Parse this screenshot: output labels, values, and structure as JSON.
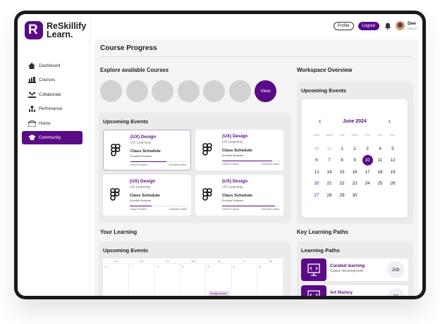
{
  "brand": {
    "line1": "ReSkillify",
    "line2": "Learn.",
    "mark": "R"
  },
  "nav": [
    {
      "label": "Dashboard",
      "icon": "home-icon",
      "active": false
    },
    {
      "label": "Courses",
      "icon": "courses-icon",
      "active": false
    },
    {
      "label": "Collaborate",
      "icon": "collaborate-icon",
      "active": false
    },
    {
      "label": "Perfomance",
      "icon": "performance-icon",
      "active": false
    },
    {
      "label": "Home",
      "icon": "home-alt-icon",
      "active": false
    },
    {
      "label": "Community",
      "icon": "community-icon",
      "active": true
    }
  ],
  "topbar": {
    "profile": "Profile",
    "logout": "Logout",
    "user_name": "Dee",
    "user_role": "User"
  },
  "main": {
    "title": "Course Progress",
    "explore_title": "Explore available Courses",
    "view_label": "View",
    "upcoming_title": "Upcoming Events",
    "cards": [
      {
        "title": "(UX) Design",
        "sub": "UX Learning",
        "schedule": "Class Schedule",
        "enrolled": "Enrolled Students",
        "left": "Lesson Progress",
        "right": "Completion status",
        "progress": 0.62,
        "selected": true
      },
      {
        "title": "(UX) Design",
        "sub": "UX Learning",
        "schedule": "Class Schedule",
        "enrolled": "Enrolled Students",
        "left": "Lesson Progress",
        "right": "Completion status",
        "progress": 0.86,
        "selected": false
      },
      {
        "title": "(UX) Design",
        "sub": "UX Learning",
        "schedule": "Class Schedule",
        "enrolled": "Enrolled Students",
        "left": "Lesson Progress",
        "right": "Completion status",
        "progress": 0.38,
        "selected": false
      },
      {
        "title": "(UX) Design",
        "sub": "UX Learning",
        "schedule": "Class Schedule",
        "enrolled": "Enrolled Students",
        "left": "Lesson Progress",
        "right": "Completion status",
        "progress": 0.92,
        "selected": false
      }
    ],
    "your_learning": "Your Learning",
    "upcoming_title_2": "Upcoming Events",
    "mini_calendar": {
      "weekdays": [
        "Sun",
        "Mon",
        "Tue",
        "Wed",
        "Thu",
        "Fri",
        "Sat"
      ],
      "days": [
        "26",
        "27",
        "28",
        "1",
        "2",
        "3",
        "4"
      ],
      "tag": "Design lecture"
    }
  },
  "workspace": {
    "title": "Workspace Overview",
    "upcoming": "Upcoming Events",
    "calendar": {
      "month": "June 2024",
      "weekdays": [
        "SUN",
        "MON",
        "TUE",
        "WED",
        "THU",
        "FRI",
        "SAT"
      ],
      "weeks": [
        [
          "30",
          "31",
          "1",
          "2",
          "3",
          "4",
          "5"
        ],
        [
          "6",
          "7",
          "8",
          "9",
          "10",
          "11",
          "12"
        ],
        [
          "13",
          "14",
          "15",
          "16",
          "17",
          "18",
          "19"
        ],
        [
          "20",
          "21",
          "22",
          "23",
          "24",
          "25",
          "26"
        ],
        [
          "27",
          "28",
          "29",
          "30",
          "",
          "",
          ""
        ]
      ],
      "today": "10"
    },
    "key_paths": "Key Learning Paths",
    "paths_title": "Learning Paths",
    "paths": [
      {
        "title": "Curated learning",
        "sub": "Career development",
        "badge": "Job"
      },
      {
        "title": "Art History",
        "sub": "",
        "badge": "72"
      }
    ]
  },
  "colors": {
    "accent": "#5a0a86",
    "panel": "#ebebeb",
    "bg": "#f4f4f4"
  }
}
